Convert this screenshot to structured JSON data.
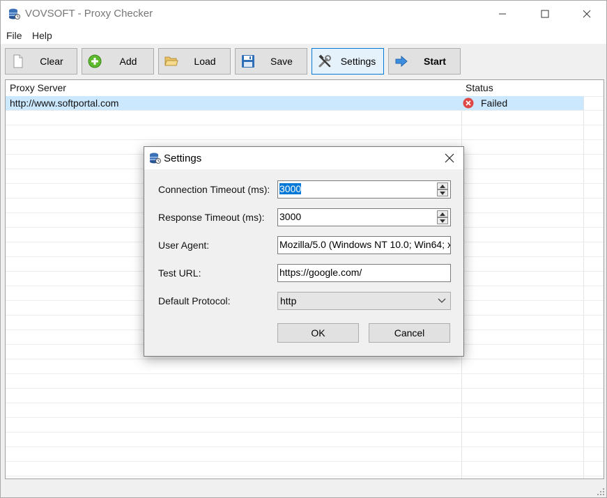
{
  "window": {
    "title": "VOVSOFT - Proxy Checker"
  },
  "menu": {
    "items": [
      "File",
      "Help"
    ]
  },
  "toolbar": {
    "buttons": [
      {
        "label": "Clear",
        "icon": "blank-page-icon"
      },
      {
        "label": "Add",
        "icon": "plus-circle-icon"
      },
      {
        "label": "Load",
        "icon": "folder-open-icon"
      },
      {
        "label": "Save",
        "icon": "floppy-disk-icon"
      },
      {
        "label": "Settings",
        "icon": "tools-icon"
      },
      {
        "label": "Start",
        "icon": "arrow-right-icon"
      }
    ]
  },
  "grid": {
    "columns": [
      "Proxy Server",
      "Status"
    ],
    "rows": [
      {
        "proxy": "http://www.softportal.com",
        "status": "Failed",
        "status_icon": "error-circle-icon"
      }
    ]
  },
  "dialog": {
    "title": "Settings",
    "fields": {
      "connection_timeout_label": "Connection Timeout (ms):",
      "connection_timeout_value": "3000",
      "response_timeout_label": "Response Timeout (ms):",
      "response_timeout_value": "3000",
      "user_agent_label": "User Agent:",
      "user_agent_value": "Mozilla/5.0 (Windows NT 10.0; Win64; x",
      "test_url_label": "Test URL:",
      "test_url_value": "https://google.com/",
      "default_protocol_label": "Default Protocol:",
      "default_protocol_value": "http"
    },
    "ok_label": "OK",
    "cancel_label": "Cancel"
  },
  "colors": {
    "accent": "#0078d7",
    "selection_row": "#cce8ff",
    "failed": "#e04848"
  }
}
